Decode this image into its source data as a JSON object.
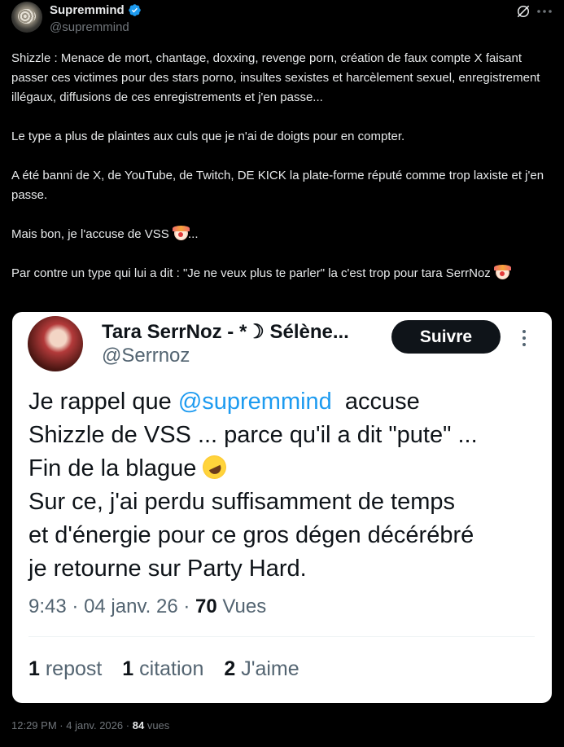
{
  "post": {
    "author_name": "Supremmind",
    "author_handle": "@supremmind",
    "paragraphs": [
      "Shizzle : Menace de mort, chantage, doxxing, revenge porn, création de faux compte X faisant passer ces victimes pour des stars porno, insultes sexistes et harcèlement sexuel, enregistrement illégaux, diffusions de ces enregistrements et j'en passe...",
      "Le type a plus de plaintes aux culs que je n'ai de doigts pour en compter.",
      "A été banni de X, de YouTube, de Twitch, DE KICK la plate-forme réputé comme trop laxiste et j'en passe.",
      "Mais bon, je l'accuse de VSS",
      "...",
      "Par contre un type qui lui a dit : \"Je ne veux plus te parler\" la c'est trop pour tara SerrNoz"
    ],
    "time": "12:29 PM",
    "date": "4 janv. 2026",
    "views_count": "84",
    "views_label": "vues",
    "sep": "·"
  },
  "quoted": {
    "author_name": "Tara SerrNoz - *☽ Sélène...",
    "author_handle": "@Serrnoz",
    "follow_label": "Suivre",
    "text_before_mention": "Je rappel que ",
    "mention": "@supremmind",
    "text_after_mention": "  accuse\nShizzle de VSS ... parce qu'il a dit \"pute\" ...\nFin de la blague ",
    "text_after_emoji": "\nSur ce, j'ai perdu suffisamment de temps\net d'énergie pour ce gros dégen décérébré\nje retourne sur Party Hard.",
    "time": "9:43",
    "date": "04 janv. 26",
    "views_count": "70",
    "views_label": "Vues",
    "sep": "·",
    "reposts_count": "1",
    "reposts_label": "repost",
    "quotes_count": "1",
    "quotes_label": "citation",
    "likes_count": "2",
    "likes_label": "J'aime"
  },
  "icons": {
    "verified": "verified-badge-icon",
    "grok": "grok-icon",
    "more": "more-icon",
    "clown": "clown-emoji",
    "rofl": "rofl-emoji"
  },
  "colors": {
    "background": "#000000",
    "text": "#e7e9ea",
    "muted": "#71767b",
    "accent": "#1d9bf0"
  }
}
